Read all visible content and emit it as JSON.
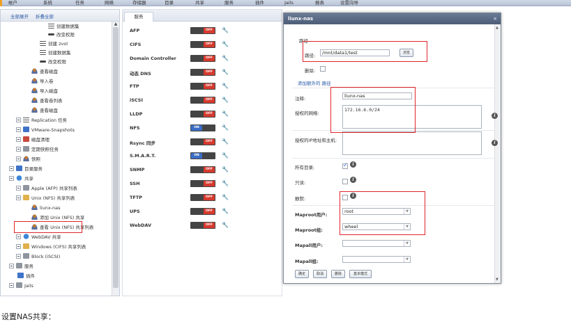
{
  "topbar": {
    "items": [
      "帐户",
      "系统",
      "任务",
      "网络",
      "存储器",
      "目录",
      "共享",
      "服务",
      "插件",
      "Jails",
      "报表",
      "设置向导"
    ]
  },
  "tree": {
    "header": {
      "expand_all": "全部展开",
      "collapse_all": "折叠全部"
    },
    "items": [
      {
        "label": "创建数据集",
        "icon": "dataset-icon"
      },
      {
        "label": "改变权限",
        "icon": "key-icon"
      },
      {
        "label": "创建 zvol",
        "icon": "dataset-icon"
      },
      {
        "label": "创建数据集",
        "icon": "dataset-icon"
      },
      {
        "label": "改变权限",
        "icon": "key-icon"
      },
      {
        "label": "查看磁盘",
        "icon": "disk-icon"
      },
      {
        "label": "导入卷",
        "icon": "disk-icon"
      },
      {
        "label": "导入磁盘",
        "icon": "disk-icon"
      },
      {
        "label": "查看卷列表",
        "icon": "disk-icon"
      },
      {
        "label": "查看磁盘",
        "icon": "disk-icon"
      },
      {
        "label": "Replication 任务",
        "icon": "replication-icon"
      },
      {
        "label": "VMware-Snapshots",
        "icon": "vmware-icon"
      },
      {
        "label": "磁盘清理",
        "icon": "scrub-icon"
      },
      {
        "label": "定期快照任务",
        "icon": "snapshot-icon"
      },
      {
        "label": "快照",
        "icon": "snapshot-icon"
      },
      {
        "label": "目录服务",
        "icon": "directory-icon"
      },
      {
        "label": "共享",
        "icon": "share-icon"
      },
      {
        "label": "Apple (AFP) 共享列表",
        "icon": "apple-icon"
      },
      {
        "label": "Unix (NFS) 共享列表",
        "icon": "folder-icon"
      },
      {
        "label": "liunx-nas",
        "icon": "nfs-share-icon"
      },
      {
        "label": "添加 Unix (NFS) 共享",
        "icon": "nfs-share-icon"
      },
      {
        "label": "查看 Unix (NFS) 共享列表",
        "icon": "nfs-share-icon"
      },
      {
        "label": "WebDAV 共享",
        "icon": "globe-icon"
      },
      {
        "label": "Windows (CIFS) 共享列表",
        "icon": "folder-icon"
      },
      {
        "label": "Block (iSCSI)",
        "icon": "iscsi-icon"
      },
      {
        "label": "服务",
        "icon": "services-icon"
      },
      {
        "label": "插件",
        "icon": "plugins-icon"
      },
      {
        "label": "Jails",
        "icon": "jails-icon"
      }
    ]
  },
  "services": {
    "tab_label": "服务",
    "items": [
      {
        "name": "AFP",
        "state": "OFF"
      },
      {
        "name": "CIFS",
        "state": "OFF"
      },
      {
        "name": "Domain Controller",
        "state": "OFF"
      },
      {
        "name": "动态 DNS",
        "state": "OFF"
      },
      {
        "name": "FTP",
        "state": "OFF"
      },
      {
        "name": "iSCSI",
        "state": "OFF"
      },
      {
        "name": "LLDP",
        "state": "OFF"
      },
      {
        "name": "NFS",
        "state": "ON"
      },
      {
        "name": "Rsync 同步",
        "state": "OFF"
      },
      {
        "name": "S.M.A.R.T.",
        "state": "ON"
      },
      {
        "name": "SNMP",
        "state": "OFF"
      },
      {
        "name": "SSH",
        "state": "OFF"
      },
      {
        "name": "TFTP",
        "state": "OFF"
      },
      {
        "name": "UPS",
        "state": "OFF"
      },
      {
        "name": "WebDAV",
        "state": "OFF"
      }
    ]
  },
  "modal": {
    "title": "liunx-nas",
    "close": "×",
    "section_label": "路径",
    "path_label": "路径:",
    "path_value": "/mnt/data1/test",
    "browse_label": "浏览",
    "delete_label": "删除:",
    "add_path_link": "添加额外的 路径",
    "comment_label": "注释:",
    "comment_value": "liunx-nas",
    "networks_label": "授权的网络:",
    "networks_value": "172.16.6.0/24",
    "hosts_label": "授权的IP地址和主机:",
    "hosts_value": "",
    "all_dirs_label": "所有目录:",
    "readonly_label": "只读:",
    "quiet_label": "静默:",
    "maproot_user_label": "Maproot用户:",
    "maproot_user_value": "root",
    "maproot_group_label": "Maproot组:",
    "maproot_group_value": "wheel",
    "mapall_user_label": "Mapall用户:",
    "mapall_user_value": "",
    "mapall_group_label": "Mapall组:",
    "mapall_group_value": "",
    "help_glyph": "i",
    "buttons": {
      "ok": "确定",
      "cancel": "取消",
      "delete": "删除",
      "basic": "基本模式"
    }
  },
  "caption": "设置NAS共享："
}
